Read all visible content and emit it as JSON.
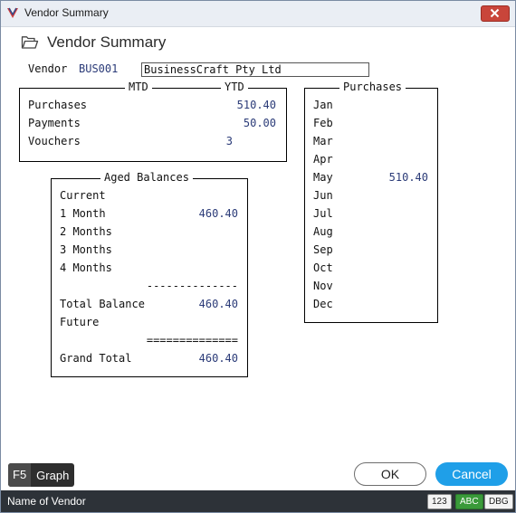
{
  "window": {
    "title": "Vendor Summary",
    "heading": "Vendor Summary"
  },
  "vendor": {
    "label": "Vendor",
    "code": "BUS001",
    "name": "BusinessCraft Pty Ltd"
  },
  "totals": {
    "mtd_label": "MTD",
    "ytd_label": "YTD",
    "rows": [
      {
        "label": "Purchases",
        "ytd": "510.40"
      },
      {
        "label": "Payments",
        "ytd": "50.00"
      },
      {
        "label": "Vouchers",
        "ytd": "3"
      }
    ]
  },
  "purchases": {
    "title": "Purchases",
    "months": [
      {
        "month": "Jan",
        "value": ""
      },
      {
        "month": "Feb",
        "value": ""
      },
      {
        "month": "Mar",
        "value": ""
      },
      {
        "month": "Apr",
        "value": ""
      },
      {
        "month": "May",
        "value": "510.40"
      },
      {
        "month": "Jun",
        "value": ""
      },
      {
        "month": "Jul",
        "value": ""
      },
      {
        "month": "Aug",
        "value": ""
      },
      {
        "month": "Sep",
        "value": ""
      },
      {
        "month": "Oct",
        "value": ""
      },
      {
        "month": "Nov",
        "value": ""
      },
      {
        "month": "Dec",
        "value": ""
      }
    ]
  },
  "aged": {
    "title": "Aged Balances",
    "rows": [
      {
        "label": "Current",
        "value": ""
      },
      {
        "label": "1 Month",
        "value": "460.40"
      },
      {
        "label": "2 Months",
        "value": ""
      },
      {
        "label": "3 Months",
        "value": ""
      },
      {
        "label": "4 Months",
        "value": ""
      }
    ],
    "divider1": "--------------",
    "total_label": "Total Balance",
    "total_value": "460.40",
    "future_label": "Future",
    "divider2": "==============",
    "grand_label": "Grand Total",
    "grand_value": "460.40"
  },
  "buttons": {
    "graph_key": "F5",
    "graph_label": "Graph",
    "ok": "OK",
    "cancel": "Cancel"
  },
  "status": {
    "text": "Name of Vendor",
    "badges": [
      "123",
      "ABC",
      "DBG"
    ]
  },
  "colors": {
    "accent": "#1f9fe8",
    "value_text": "#2b3b78",
    "status_bg": "#2d3238",
    "abc_badge": "#3a9a3a"
  }
}
